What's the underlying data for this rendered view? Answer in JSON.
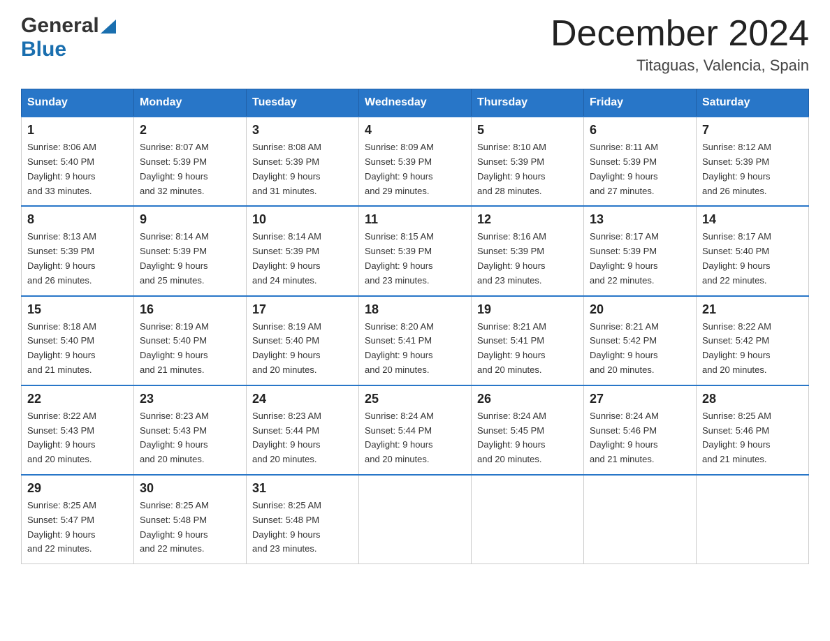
{
  "header": {
    "logo_general": "General",
    "logo_blue": "Blue",
    "month_title": "December 2024",
    "location": "Titaguas, Valencia, Spain"
  },
  "days_of_week": [
    "Sunday",
    "Monday",
    "Tuesday",
    "Wednesday",
    "Thursday",
    "Friday",
    "Saturday"
  ],
  "weeks": [
    [
      {
        "day": "1",
        "sunrise": "8:06 AM",
        "sunset": "5:40 PM",
        "daylight": "9 hours and 33 minutes."
      },
      {
        "day": "2",
        "sunrise": "8:07 AM",
        "sunset": "5:39 PM",
        "daylight": "9 hours and 32 minutes."
      },
      {
        "day": "3",
        "sunrise": "8:08 AM",
        "sunset": "5:39 PM",
        "daylight": "9 hours and 31 minutes."
      },
      {
        "day": "4",
        "sunrise": "8:09 AM",
        "sunset": "5:39 PM",
        "daylight": "9 hours and 29 minutes."
      },
      {
        "day": "5",
        "sunrise": "8:10 AM",
        "sunset": "5:39 PM",
        "daylight": "9 hours and 28 minutes."
      },
      {
        "day": "6",
        "sunrise": "8:11 AM",
        "sunset": "5:39 PM",
        "daylight": "9 hours and 27 minutes."
      },
      {
        "day": "7",
        "sunrise": "8:12 AM",
        "sunset": "5:39 PM",
        "daylight": "9 hours and 26 minutes."
      }
    ],
    [
      {
        "day": "8",
        "sunrise": "8:13 AM",
        "sunset": "5:39 PM",
        "daylight": "9 hours and 26 minutes."
      },
      {
        "day": "9",
        "sunrise": "8:14 AM",
        "sunset": "5:39 PM",
        "daylight": "9 hours and 25 minutes."
      },
      {
        "day": "10",
        "sunrise": "8:14 AM",
        "sunset": "5:39 PM",
        "daylight": "9 hours and 24 minutes."
      },
      {
        "day": "11",
        "sunrise": "8:15 AM",
        "sunset": "5:39 PM",
        "daylight": "9 hours and 23 minutes."
      },
      {
        "day": "12",
        "sunrise": "8:16 AM",
        "sunset": "5:39 PM",
        "daylight": "9 hours and 23 minutes."
      },
      {
        "day": "13",
        "sunrise": "8:17 AM",
        "sunset": "5:39 PM",
        "daylight": "9 hours and 22 minutes."
      },
      {
        "day": "14",
        "sunrise": "8:17 AM",
        "sunset": "5:40 PM",
        "daylight": "9 hours and 22 minutes."
      }
    ],
    [
      {
        "day": "15",
        "sunrise": "8:18 AM",
        "sunset": "5:40 PM",
        "daylight": "9 hours and 21 minutes."
      },
      {
        "day": "16",
        "sunrise": "8:19 AM",
        "sunset": "5:40 PM",
        "daylight": "9 hours and 21 minutes."
      },
      {
        "day": "17",
        "sunrise": "8:19 AM",
        "sunset": "5:40 PM",
        "daylight": "9 hours and 20 minutes."
      },
      {
        "day": "18",
        "sunrise": "8:20 AM",
        "sunset": "5:41 PM",
        "daylight": "9 hours and 20 minutes."
      },
      {
        "day": "19",
        "sunrise": "8:21 AM",
        "sunset": "5:41 PM",
        "daylight": "9 hours and 20 minutes."
      },
      {
        "day": "20",
        "sunrise": "8:21 AM",
        "sunset": "5:42 PM",
        "daylight": "9 hours and 20 minutes."
      },
      {
        "day": "21",
        "sunrise": "8:22 AM",
        "sunset": "5:42 PM",
        "daylight": "9 hours and 20 minutes."
      }
    ],
    [
      {
        "day": "22",
        "sunrise": "8:22 AM",
        "sunset": "5:43 PM",
        "daylight": "9 hours and 20 minutes."
      },
      {
        "day": "23",
        "sunrise": "8:23 AM",
        "sunset": "5:43 PM",
        "daylight": "9 hours and 20 minutes."
      },
      {
        "day": "24",
        "sunrise": "8:23 AM",
        "sunset": "5:44 PM",
        "daylight": "9 hours and 20 minutes."
      },
      {
        "day": "25",
        "sunrise": "8:24 AM",
        "sunset": "5:44 PM",
        "daylight": "9 hours and 20 minutes."
      },
      {
        "day": "26",
        "sunrise": "8:24 AM",
        "sunset": "5:45 PM",
        "daylight": "9 hours and 20 minutes."
      },
      {
        "day": "27",
        "sunrise": "8:24 AM",
        "sunset": "5:46 PM",
        "daylight": "9 hours and 21 minutes."
      },
      {
        "day": "28",
        "sunrise": "8:25 AM",
        "sunset": "5:46 PM",
        "daylight": "9 hours and 21 minutes."
      }
    ],
    [
      {
        "day": "29",
        "sunrise": "8:25 AM",
        "sunset": "5:47 PM",
        "daylight": "9 hours and 22 minutes."
      },
      {
        "day": "30",
        "sunrise": "8:25 AM",
        "sunset": "5:48 PM",
        "daylight": "9 hours and 22 minutes."
      },
      {
        "day": "31",
        "sunrise": "8:25 AM",
        "sunset": "5:48 PM",
        "daylight": "9 hours and 23 minutes."
      },
      null,
      null,
      null,
      null
    ]
  ],
  "labels": {
    "sunrise_prefix": "Sunrise: ",
    "sunset_prefix": "Sunset: ",
    "daylight_prefix": "Daylight: "
  }
}
